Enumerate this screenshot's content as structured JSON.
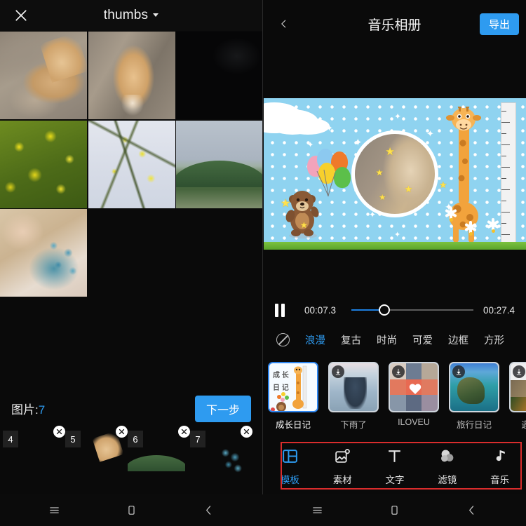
{
  "left": {
    "header": {
      "close_icon": "close-icon",
      "title": "thumbs",
      "dropdown_icon": "chevron-down-icon"
    },
    "grid": [
      {
        "name": "dog-lying-photo",
        "art": "dog1"
      },
      {
        "name": "dog-standing-photo",
        "art": "dog2"
      },
      {
        "name": "dark-night-photo",
        "art": "dark1"
      },
      {
        "name": "rapeseed-field-photo",
        "art": "rape1"
      },
      {
        "name": "rapeseed-branch-photo",
        "art": "rape2"
      },
      {
        "name": "green-hill-photo",
        "art": "hill1"
      },
      {
        "name": "bride-bouquet-photo",
        "art": "bride1"
      }
    ],
    "count_label": "图片:",
    "count_value": "7",
    "next_label": "下一步",
    "selected": [
      {
        "index": "4",
        "art": "rape1",
        "close_icon": "close-icon"
      },
      {
        "index": "5",
        "art": "dog1",
        "close_icon": "close-icon"
      },
      {
        "index": "6",
        "art": "hill1",
        "close_icon": "close-icon"
      },
      {
        "index": "7",
        "art": "bride1",
        "close_icon": "close-icon"
      }
    ]
  },
  "right": {
    "header": {
      "back_icon": "chevron-left-icon",
      "title": "音乐相册",
      "export_label": "导出"
    },
    "preview": {
      "theme": "growth-diary",
      "background_color": "#8fd3f0",
      "photo_shape": "circle"
    },
    "playback": {
      "state_icon": "pause-icon",
      "current_time": "00:07.3",
      "total_time": "00:27.4",
      "progress_percent": 27
    },
    "categories": [
      {
        "label": "浪漫",
        "active": true
      },
      {
        "label": "复古",
        "active": false
      },
      {
        "label": "时尚",
        "active": false
      },
      {
        "label": "可爱",
        "active": false
      },
      {
        "label": "边框",
        "active": false
      },
      {
        "label": "方形",
        "active": false
      }
    ],
    "none_icon": "no-effect-icon",
    "templates": [
      {
        "label": "成长日记",
        "art": "growth",
        "selected": true,
        "download": false
      },
      {
        "label": "下雨了",
        "art": "rain",
        "selected": false,
        "download": true
      },
      {
        "label": "ILOVEU",
        "art": "love",
        "selected": false,
        "download": true
      },
      {
        "label": "旅行日记",
        "art": "travel",
        "selected": false,
        "download": true
      },
      {
        "label": "遇见爱",
        "art": "meet",
        "selected": false,
        "download": true
      }
    ],
    "toolbar": [
      {
        "label": "模板",
        "icon": "template-grid-icon",
        "active": true
      },
      {
        "label": "素材",
        "icon": "sticker-image-icon",
        "active": false
      },
      {
        "label": "文字",
        "icon": "text-t-icon",
        "active": false
      },
      {
        "label": "滤镜",
        "icon": "filter-circles-icon",
        "active": false
      },
      {
        "label": "音乐",
        "icon": "music-note-icon",
        "active": false
      }
    ],
    "highlight_color": "#d92c2c"
  },
  "navbar": [
    {
      "icon": "menu-icon"
    },
    {
      "icon": "home-square-icon"
    },
    {
      "icon": "back-chevron-icon"
    }
  ],
  "theme": {
    "accent": "#2e9bf0",
    "background": "#0a0a0a",
    "text": "#f2f2f2"
  }
}
